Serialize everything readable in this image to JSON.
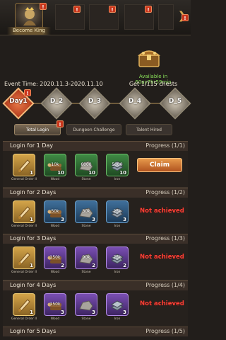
{
  "topbar": {
    "avatar_label": "Become King",
    "badges": [
      "!",
      "!",
      "!",
      "!",
      "!"
    ]
  },
  "header": {
    "chest_label": "Available in 60ay7hr59min",
    "chest_count": "Get 1/115 chests",
    "event_time": "Event Time: 2020.11.3-2020.11.10"
  },
  "days": [
    "Day1",
    "D_2",
    "D_3",
    "D_4",
    "D_5"
  ],
  "tabs": [
    "Total Login",
    "Dungeon Challenge",
    "Talent Hired"
  ],
  "sections": [
    {
      "title": "Login for 1 Day",
      "progress": "Progress (1/1)",
      "action": "Claim",
      "items": [
        {
          "num": "",
          "qty": "1",
          "name": "General Order II",
          "rarity": "gold",
          "icon": "scroll-icon"
        },
        {
          "num": "10k",
          "qty": "10",
          "name": "Wood",
          "rarity": "green",
          "icon": "wood-icon"
        },
        {
          "num": "6000",
          "qty": "10",
          "name": "Stone",
          "rarity": "green",
          "icon": "stone-icon"
        },
        {
          "num": "5000",
          "qty": "10",
          "name": "Iron",
          "rarity": "green",
          "icon": "iron-icon"
        }
      ]
    },
    {
      "title": "Login for 2 Days",
      "progress": "Progress (1/2)",
      "action": "Not achieved",
      "items": [
        {
          "num": "",
          "qty": "1",
          "name": "General Order II",
          "rarity": "gold",
          "icon": "scroll-icon"
        },
        {
          "num": "50k",
          "qty": "3",
          "name": "Wood",
          "rarity": "blue",
          "icon": "wood-icon"
        },
        {
          "num": "30k",
          "qty": "3",
          "name": "Stone",
          "rarity": "blue",
          "icon": "stone-icon"
        },
        {
          "num": "25k",
          "qty": "3",
          "name": "Iron",
          "rarity": "blue",
          "icon": "iron-icon"
        }
      ]
    },
    {
      "title": "Login for 3 Days",
      "progress": "Progress (1/3)",
      "action": "Not achieved",
      "items": [
        {
          "num": "",
          "qty": "1",
          "name": "General Order II",
          "rarity": "gold",
          "icon": "scroll-icon"
        },
        {
          "num": "150k",
          "qty": "2",
          "name": "Wood",
          "rarity": "purple",
          "icon": "wood-icon"
        },
        {
          "num": "90k",
          "qty": "2",
          "name": "Stone",
          "rarity": "purple",
          "icon": "stone-icon"
        },
        {
          "num": "75k",
          "qty": "2",
          "name": "Iron",
          "rarity": "purple",
          "icon": "iron-icon"
        }
      ]
    },
    {
      "title": "Login for 4 Days",
      "progress": "Progress (1/4)",
      "action": "Not achieved",
      "items": [
        {
          "num": "",
          "qty": "1",
          "name": "General Order II",
          "rarity": "gold",
          "icon": "scroll-icon"
        },
        {
          "num": "150k",
          "qty": "3",
          "name": "Wood",
          "rarity": "purple",
          "icon": "wood-icon"
        },
        {
          "num": "",
          "qty": "3",
          "name": "Stone",
          "rarity": "purple",
          "icon": "stone-icon"
        },
        {
          "num": "",
          "qty": "3",
          "name": "Iron",
          "rarity": "purple",
          "icon": "iron-icon"
        }
      ]
    },
    {
      "title": "Login for 5 Days",
      "progress": "Progress (1/5)",
      "action": "",
      "items": []
    }
  ],
  "colors": {
    "accent": "#e79a4b",
    "not_achieved": "#ff4237",
    "available": "#8be35a"
  }
}
